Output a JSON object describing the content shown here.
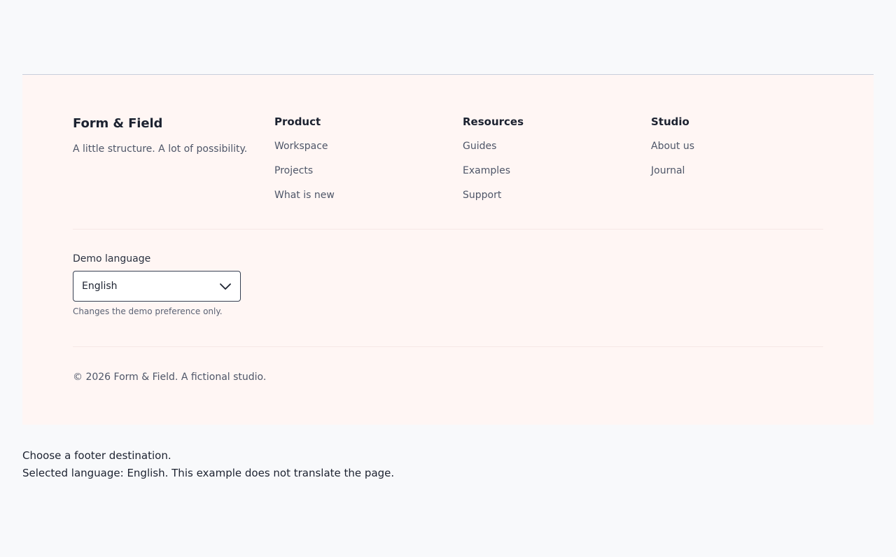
{
  "footer": {
    "brand": {
      "name": "Form & Field",
      "tagline": "A little structure. A lot of possibility."
    },
    "columns": [
      {
        "title": "Product",
        "links": [
          "Workspace",
          "Projects",
          "What is new"
        ]
      },
      {
        "title": "Resources",
        "links": [
          "Guides",
          "Examples",
          "Support"
        ]
      },
      {
        "title": "Studio",
        "links": [
          "About us",
          "Journal"
        ]
      }
    ],
    "language": {
      "label": "Demo language",
      "selected": "English",
      "hint": "Changes the demo preference only."
    },
    "copyright": "© 2026 Form & Field. A fictional studio."
  },
  "status": {
    "line1": "Choose a footer destination.",
    "line2": "Selected language: English. This example does not translate the page."
  },
  "icons": {
    "select_chevron": "chevron-down-icon"
  }
}
